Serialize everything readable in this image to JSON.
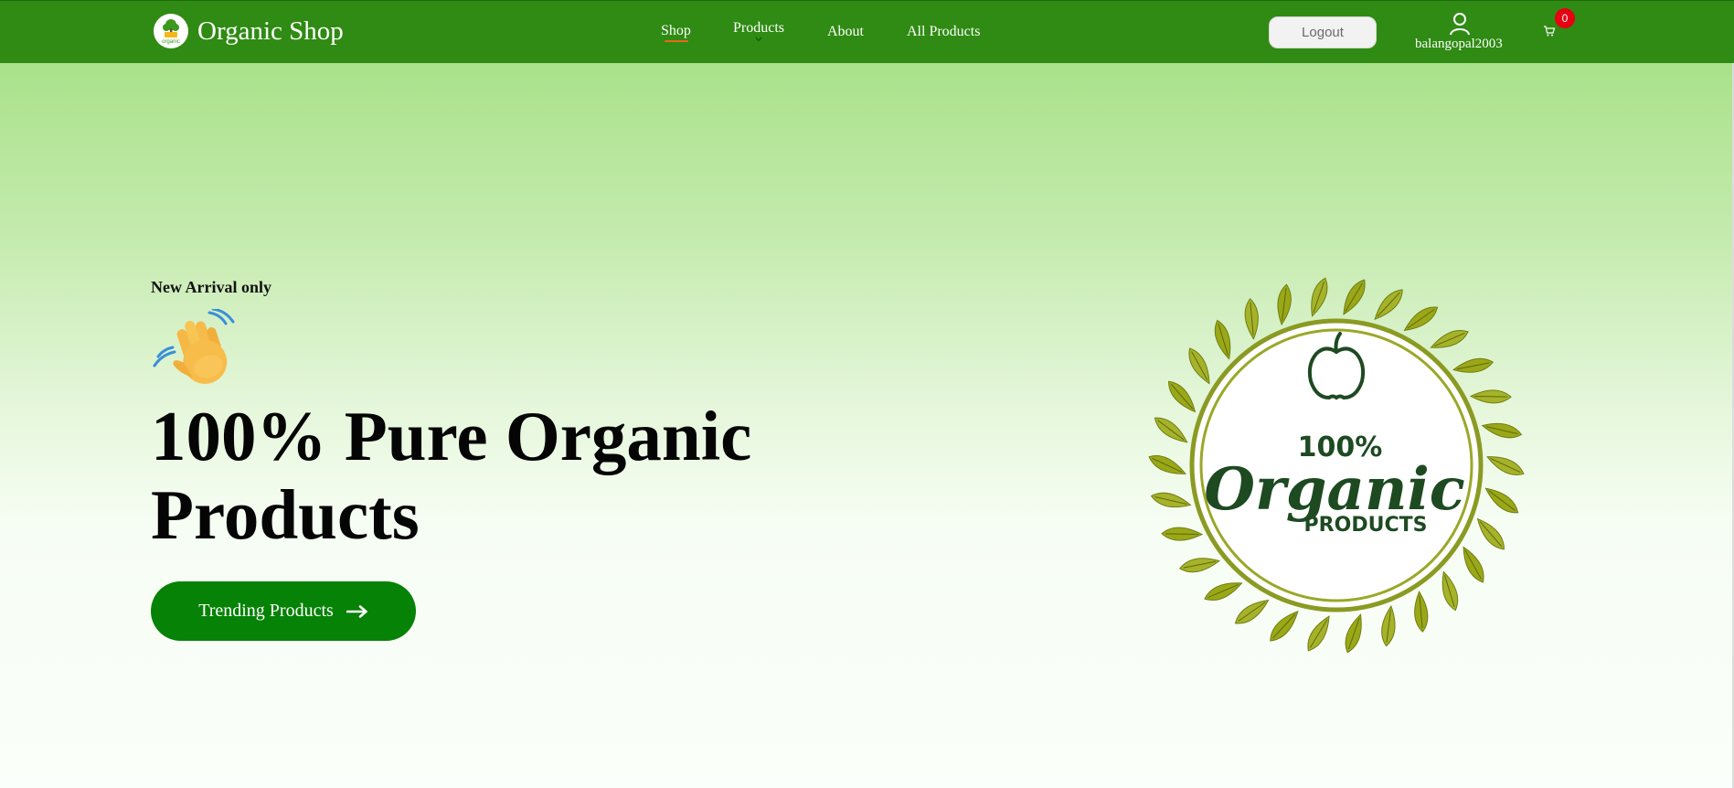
{
  "brand": {
    "name": "Organic Shop",
    "logo_text": "organic"
  },
  "nav": {
    "items": [
      {
        "label": "Shop",
        "active": true
      },
      {
        "label": "Products",
        "has_dropdown": true
      },
      {
        "label": "About"
      },
      {
        "label": "All Products"
      }
    ]
  },
  "account": {
    "logout_label": "Logout",
    "username": "balangopal2003",
    "cart_count": "0"
  },
  "hero": {
    "eyebrow": "New Arrival only",
    "headline": "100% Pure Organic Products",
    "cta_label": "Trending Products",
    "emoji": "waving-hand"
  },
  "badge": {
    "percent": "100%",
    "word": "Organic",
    "sub": "PRODUCTS"
  },
  "colors": {
    "navbar": "#2f8b13",
    "cta": "#068206",
    "badge_leaves": "#9aa818",
    "badge_text": "#1e4a22",
    "cart_badge": "#e60012",
    "shop_underline": "#e46b18"
  }
}
